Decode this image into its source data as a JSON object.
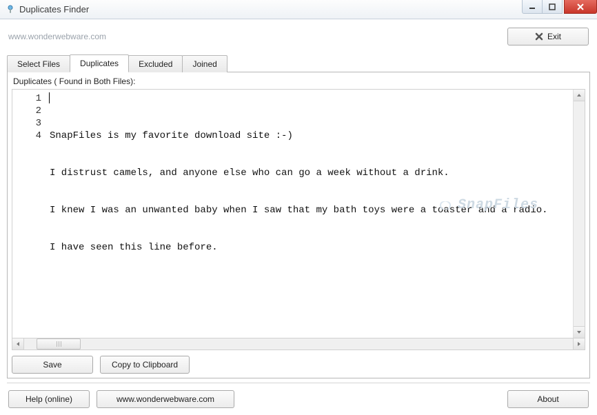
{
  "window": {
    "title": "Duplicates Finder"
  },
  "header": {
    "url": "www.wonderwebware.com",
    "exit_label": "Exit"
  },
  "tabs": [
    {
      "label": "Select Files"
    },
    {
      "label": "Duplicates"
    },
    {
      "label": "Excluded"
    },
    {
      "label": "Joined"
    }
  ],
  "panel": {
    "label": "Duplicates ( Found in Both Files):",
    "lines": [
      "SnapFiles is my favorite download site :-)",
      "I distrust camels, and anyone else who can go a week without a drink.",
      "I knew I was an unwanted baby when I saw that my bath toys were a toaster and a radio.",
      "I have seen this line before."
    ]
  },
  "actions": {
    "save_label": "Save",
    "copy_label": "Copy to Clipboard"
  },
  "footer": {
    "help_label": "Help (online)",
    "site_label": "www.wonderwebware.com",
    "about_label": "About"
  },
  "watermark": "SnapFiles"
}
